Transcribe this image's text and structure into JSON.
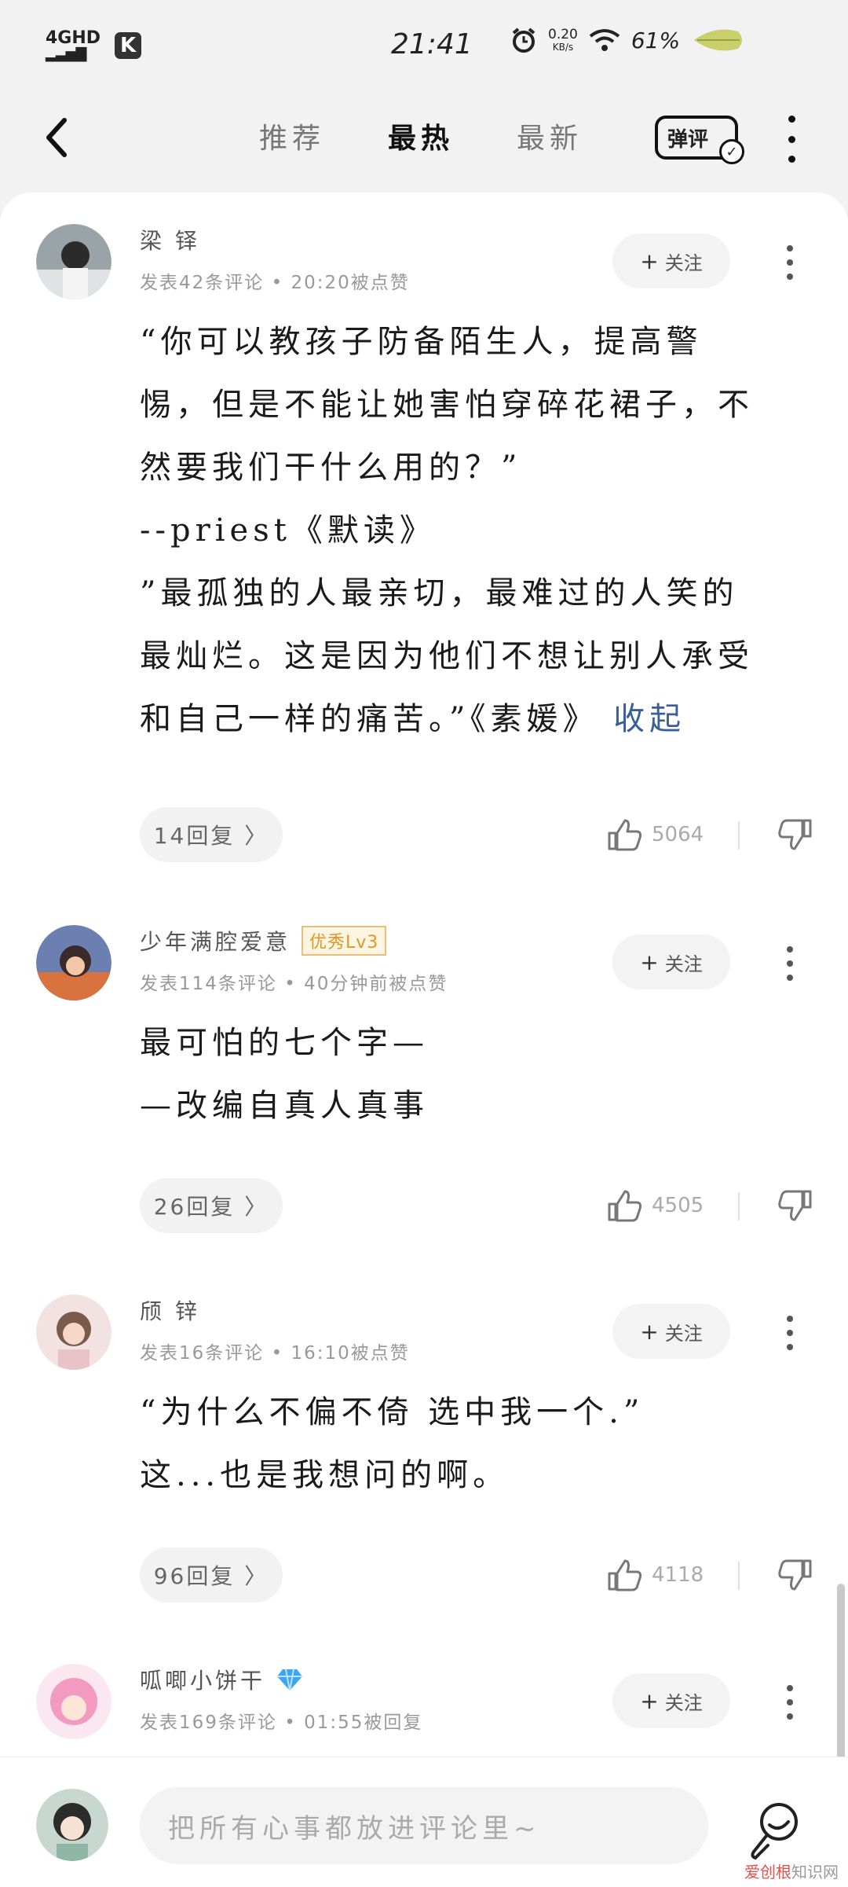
{
  "status_bar": {
    "network": "4GHD",
    "badge": "K",
    "time": "21:41",
    "speed_value": "0.20",
    "speed_unit": "KB/s",
    "battery": "61%"
  },
  "nav": {
    "tabs": [
      "推荐",
      "最热",
      "最新"
    ],
    "active_tab": 1,
    "danping_label": "弹评"
  },
  "comments": [
    {
      "username": "梁 铎",
      "meta": "发表42条评论 • 20:20被点赞",
      "follow_label": "关注",
      "lines": [
        "“你可以教孩子防备陌生人，提高警",
        "惕，但是不能让她害怕穿碎花裙子，不",
        "然要我们干什么用的？”",
        "--priest《默读》",
        "”最孤独的人最亲切，最难过的人笑的",
        "最灿烂。这是因为他们不想让别人承受",
        "和自己一样的痛苦。”《素媛》"
      ],
      "collapse_label": "收起",
      "replies": "14回复 〉",
      "likes": "5064"
    },
    {
      "username": "少年满腔爱意",
      "level_badge": "优秀Lv3",
      "meta": "发表114条评论 • 40分钟前被点赞",
      "follow_label": "关注",
      "lines": [
        "最可怕的七个字—",
        "—改编自真人真事"
      ],
      "replies": "26回复 〉",
      "likes": "4505"
    },
    {
      "username": "颀 锌",
      "meta": "发表16条评论 • 16:10被点赞",
      "follow_label": "关注",
      "lines": [
        "“为什么不偏不倚 选中我一个.”",
        "这...也是我想问的啊。"
      ],
      "replies": "96回复 〉",
      "likes": "4118"
    },
    {
      "username": "呱唧小饼干",
      "meta": "发表169条评论 • 01:55被回复",
      "follow_label": "关注"
    }
  ],
  "input": {
    "placeholder": "把所有心事都放进评论里~"
  },
  "watermark": {
    "brand": "爱创根",
    "site": "知识网"
  },
  "colors": {
    "collapse_link": "#3a5f94",
    "level_badge": "#d79a2b",
    "diamond": "#3ba6f2"
  }
}
